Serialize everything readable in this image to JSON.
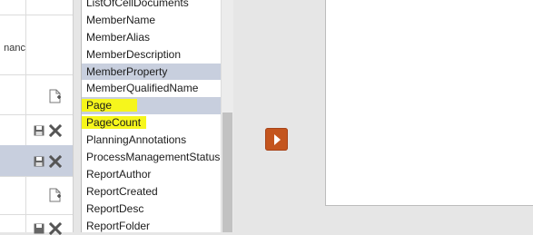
{
  "grid": {
    "column_header": "nanc",
    "icons": [
      {
        "name": "new-document-icon"
      },
      {
        "name": "save-icon"
      },
      {
        "name": "delete-icon"
      }
    ]
  },
  "property_list": {
    "items": [
      {
        "label": "ListOfCellDocuments",
        "selected": false,
        "highlighted": false
      },
      {
        "label": "MemberName",
        "selected": false,
        "highlighted": false
      },
      {
        "label": "MemberAlias",
        "selected": false,
        "highlighted": false
      },
      {
        "label": "MemberDescription",
        "selected": false,
        "highlighted": false
      },
      {
        "label": "MemberProperty",
        "selected": true,
        "highlighted": false
      },
      {
        "label": "MemberQualifiedName",
        "selected": false,
        "highlighted": false
      },
      {
        "label": "Page",
        "selected": true,
        "highlighted": true
      },
      {
        "label": "PageCount",
        "selected": false,
        "highlighted": true
      },
      {
        "label": "PlanningAnnotations",
        "selected": false,
        "highlighted": false
      },
      {
        "label": "ProcessManagementStatus",
        "selected": false,
        "highlighted": false
      },
      {
        "label": "ReportAuthor",
        "selected": false,
        "highlighted": false
      },
      {
        "label": "ReportCreated",
        "selected": false,
        "highlighted": false
      },
      {
        "label": "ReportDesc",
        "selected": false,
        "highlighted": false
      },
      {
        "label": "ReportFolder",
        "selected": false,
        "highlighted": false
      }
    ]
  },
  "move_button": {
    "icon": "arrow-right-icon"
  },
  "colors": {
    "selection": "#c8cfde",
    "highlight": "#f6f61c",
    "move_button": "#c4551e"
  }
}
